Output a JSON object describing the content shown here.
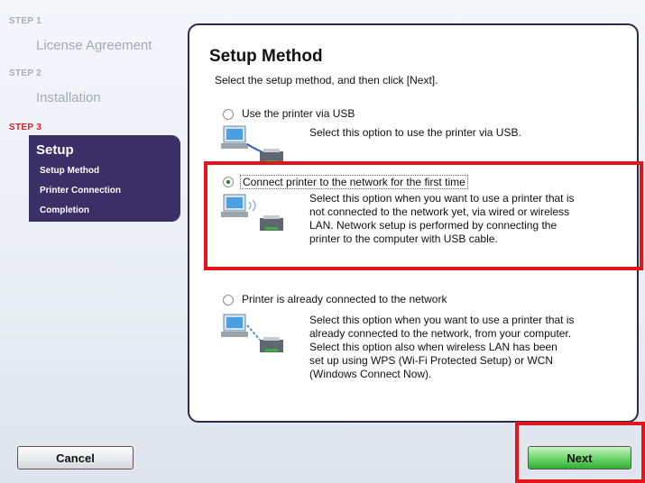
{
  "sidebar": {
    "step1_label": "STEP 1",
    "step1_title": "License Agreement",
    "step2_label": "STEP 2",
    "step2_title": "Installation",
    "step3_label": "STEP 3",
    "panel_title": "Setup",
    "items": [
      {
        "label": "Setup Method"
      },
      {
        "label": "Printer Connection"
      },
      {
        "label": "Completion"
      }
    ]
  },
  "main": {
    "title": "Setup Method",
    "subtitle": "Select the setup method, and then click [Next].",
    "options": [
      {
        "label": "Use the printer via USB",
        "desc": [
          "Select this option to use the printer via USB."
        ],
        "selected": false
      },
      {
        "label": "Connect printer to the network for the first time",
        "desc": [
          "Select this option when you want to use a printer that is",
          "not connected to the network yet, via wired or wireless",
          "LAN. Network setup is performed by connecting the",
          "printer to the computer with USB cable."
        ],
        "selected": true
      },
      {
        "label": "Printer is already connected to the network",
        "desc": [
          "Select this option when you want to use a printer that is",
          "already connected to the network, from your computer.",
          "Select this option also when wireless LAN has been",
          "set up using WPS (Wi-Fi Protected Setup) or WCN",
          "(Windows Connect Now)."
        ],
        "selected": false
      }
    ]
  },
  "footer": {
    "cancel_label": "Cancel",
    "next_label": "Next"
  },
  "colors": {
    "highlight": "#e3151a",
    "panel": "#3a2f67",
    "active_step": "#e0201f"
  }
}
